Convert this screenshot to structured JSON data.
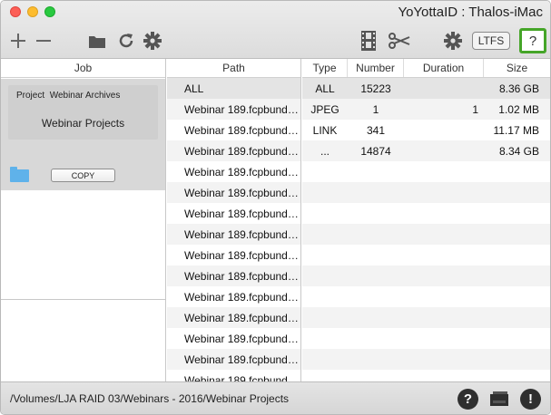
{
  "window": {
    "title": "YoYottaID : Thalos-iMac"
  },
  "toolbar": {
    "icons": [
      "plus-icon",
      "minus-icon",
      "folder-icon",
      "refresh-icon",
      "gear-icon",
      "film-icon",
      "scissors-icon",
      "gear-icon"
    ],
    "ltfs_label": "LTFS",
    "help_label": "?"
  },
  "job_pane": {
    "header": "Job",
    "project_label": "Project",
    "project_name": "Webinar Archives",
    "job_name": "Webinar Projects",
    "copy_label": "COPY"
  },
  "path_pane": {
    "header": "Path",
    "rows": [
      "ALL",
      "Webinar 189.fcpbund…",
      "Webinar 189.fcpbund…",
      "Webinar 189.fcpbund…",
      "Webinar 189.fcpbund…",
      "Webinar 189.fcpbund…",
      "Webinar 189.fcpbund…",
      "Webinar 189.fcpbund…",
      "Webinar 189.fcpbund…",
      "Webinar 189.fcpbund…",
      "Webinar 189.fcpbund…",
      "Webinar 189.fcpbund…",
      "Webinar 189.fcpbund…",
      "Webinar 189.fcpbund…",
      "Webinar 189.fcpbund…"
    ]
  },
  "stats_pane": {
    "headers": {
      "type": "Type",
      "number": "Number",
      "duration": "Duration",
      "size": "Size"
    },
    "rows": [
      {
        "type": "ALL",
        "number": "15223",
        "duration": "",
        "size": "8.36 GB"
      },
      {
        "type": "JPEG",
        "number": "1",
        "duration": "1",
        "size": "1.02 MB"
      },
      {
        "type": "LINK",
        "number": "341",
        "duration": "",
        "size": "11.17 MB"
      },
      {
        "type": "...",
        "number": "14874",
        "duration": "",
        "size": "8.34 GB"
      }
    ]
  },
  "status_bar": {
    "path": "/Volumes/LJA RAID 03/Webinars - 2016/Webinar Projects",
    "help_label": "?",
    "alert_label": "!"
  },
  "colors": {
    "help_border": "#45a528",
    "folder": "#5fb2ea"
  }
}
